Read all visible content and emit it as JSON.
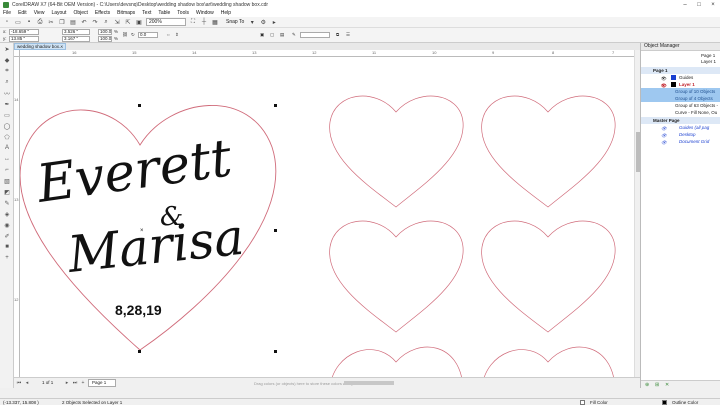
{
  "window": {
    "title": "CorelDRAW X7 (64-Bit OEM Version) - C:\\Users\\devsnq\\Desktop\\wedding shadow box\\art\\wedding shadow box.cdr",
    "controls": [
      "–",
      "□",
      "×"
    ]
  },
  "menu": [
    "File",
    "Edit",
    "View",
    "Layout",
    "Object",
    "Effects",
    "Bitmaps",
    "Text",
    "Table",
    "Tools",
    "Window",
    "Help"
  ],
  "toolbar": {
    "zoom": "200%",
    "snap_to": "Snap To"
  },
  "propbar": {
    "x": "-18.659 \"",
    "y": "13.85 \"",
    "width": "3.526 \"",
    "height": "3.167 \"",
    "scale_w": "100.0",
    "scale_h": "100.0",
    "scale_unit": "%",
    "angle": "0.0"
  },
  "document_tab": {
    "label": "wedding shadow box...",
    "close": "×"
  },
  "ruler": {
    "h_labels": [
      "16",
      "15",
      "14",
      "13",
      "12",
      "11",
      "10",
      "9",
      "8",
      "7"
    ],
    "v_labels": [
      "14",
      "13",
      "12"
    ]
  },
  "canvas": {
    "line1": "Everett",
    "amp": "&",
    "line2": "Marisa",
    "date": "8,28,19"
  },
  "navigation": {
    "page_count": "1 of 1",
    "page_tab": "Page 1",
    "hint": "Drag colors (or objects) here to store these colors with your document"
  },
  "status": {
    "coords": "(-13.337, 15.808 )",
    "selection": "2 Objects Selected on Layer 1",
    "fill": "Fill Color",
    "outline": "Outline Color"
  },
  "object_manager": {
    "title": "Object Manager",
    "page_header": [
      "Page 1",
      "Layer 1"
    ],
    "rows": [
      {
        "label": "Page 1",
        "style": "hdr"
      },
      {
        "label": "Guides",
        "style": "normal"
      },
      {
        "label": "Layer 1",
        "style": "layer"
      },
      {
        "label": "Group of 10 Objects",
        "style": "sel"
      },
      {
        "label": "Group of 4 Objects",
        "style": "sel"
      },
      {
        "label": "Group of 63 Objects -",
        "style": "normal"
      },
      {
        "label": "Curve - Fill None, Ou",
        "style": "normal"
      },
      {
        "label": "Master Page",
        "style": "hdr"
      },
      {
        "label": "Guides (all pag",
        "style": "italic"
      },
      {
        "label": "Desktop",
        "style": "italic"
      },
      {
        "label": "Document Grid",
        "style": "italic"
      }
    ]
  },
  "colors": {
    "heart_outline": "#d06b7a",
    "script_text": "#111111",
    "selection_blue": "#9ec8f0",
    "canvas_bg": "#ffffff"
  }
}
